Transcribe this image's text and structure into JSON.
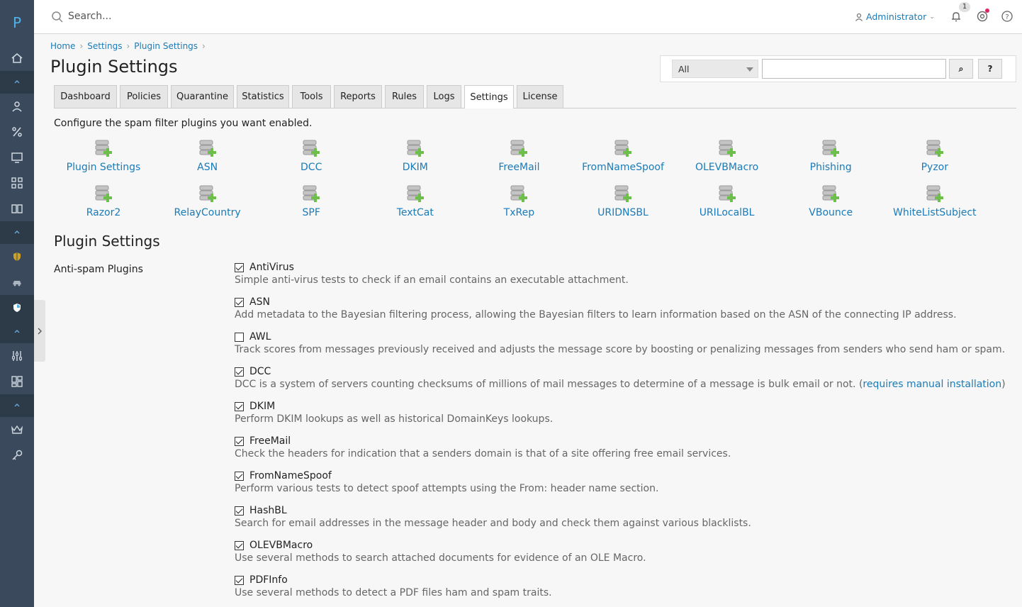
{
  "app": {
    "logo": "P"
  },
  "topbar": {
    "search_placeholder": "Search...",
    "user": "Administrator",
    "notifications_count": "1"
  },
  "breadcrumb": [
    "Home",
    "Settings",
    "Plugin Settings"
  ],
  "page": {
    "title": "Plugin Settings"
  },
  "search": {
    "filter_value": "All",
    "go_label": "⌕",
    "help_label": "?"
  },
  "tabs": [
    "Dashboard",
    "Policies",
    "Quarantine",
    "Statistics",
    "Tools",
    "Reports",
    "Rules",
    "Logs",
    "Settings",
    "License"
  ],
  "active_tab": "Settings",
  "intro": "Configure the spam filter plugins you want enabled.",
  "plugins": [
    "Plugin Settings",
    "ASN",
    "DCC",
    "DKIM",
    "FreeMail",
    "FromNameSpoof",
    "OLEVBMacro",
    "Phishing",
    "Pyzor",
    "Razor2",
    "RelayCountry",
    "SPF",
    "TextCat",
    "TxRep",
    "URIDNSBL",
    "URILocalBL",
    "VBounce",
    "WhiteListSubject"
  ],
  "section": {
    "title": "Plugin Settings",
    "label": "Anti-spam Plugins"
  },
  "options": [
    {
      "name": "AntiVirus",
      "checked": true,
      "desc": "Simple anti-virus tests to check if an email contains an executable attachment."
    },
    {
      "name": "ASN",
      "checked": true,
      "desc": "Add metadata to the Bayesian filtering process, allowing the Bayesian filters to learn information based on the ASN of the connecting IP address."
    },
    {
      "name": "AWL",
      "checked": false,
      "desc": "Track scores from messages previously received and adjusts the message score by boosting or penalizing messages from senders who send ham or spam."
    },
    {
      "name": "DCC",
      "checked": true,
      "desc": "DCC is a system of servers counting checksums of millions of mail messages to determine of a message is bulk email or not. (",
      "link": "requires manual installation",
      "desc_end": ")"
    },
    {
      "name": "DKIM",
      "checked": true,
      "desc": "Perform DKIM lookups as well as historical DomainKeys lookups."
    },
    {
      "name": "FreeMail",
      "checked": true,
      "desc": "Check the headers for indication that a senders domain is that of a site offering free email services."
    },
    {
      "name": "FromNameSpoof",
      "checked": true,
      "desc": "Perform various tests to detect spoof attempts using the From: header name section."
    },
    {
      "name": "HashBL",
      "checked": true,
      "desc": "Search for email addresses in the message header and body and check them against various blacklists."
    },
    {
      "name": "OLEVBMacro",
      "checked": true,
      "desc": "Use several methods to search attached documents for evidence of an OLE Macro."
    },
    {
      "name": "PDFInfo",
      "checked": true,
      "desc": "Use several methods to detect a PDF files ham and spam traits."
    }
  ],
  "colors": {
    "sidebar": "#3a4a5c",
    "link": "#1a7bb8",
    "accent_green": "#6cc04a"
  }
}
